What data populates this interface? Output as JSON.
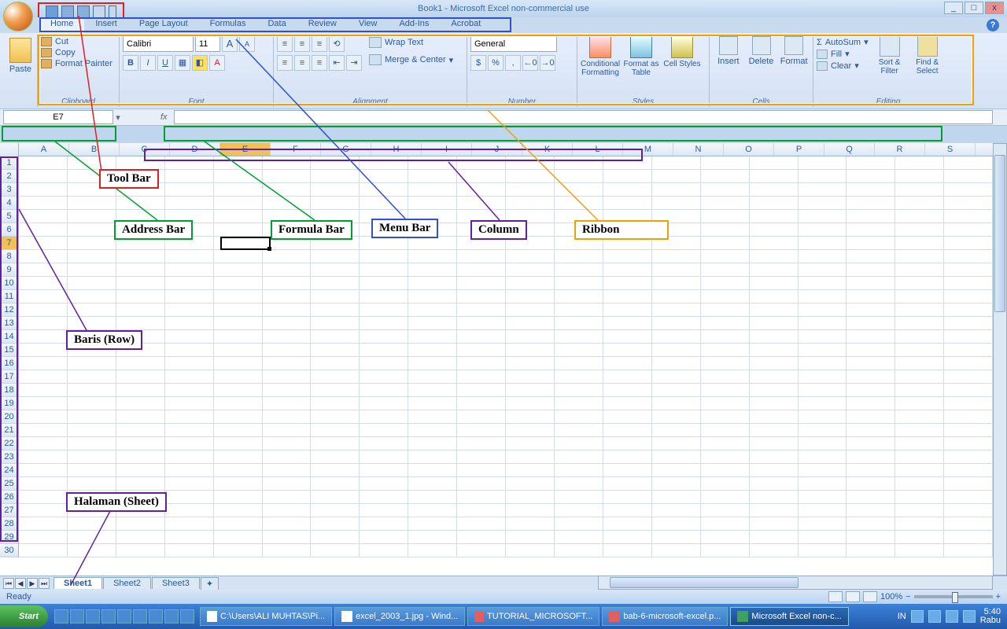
{
  "title": "Book1 - Microsoft Excel non-commercial use",
  "window": {
    "min": "_",
    "max": "□",
    "close": "x"
  },
  "tabs": [
    "Home",
    "Insert",
    "Page Layout",
    "Formulas",
    "Data",
    "Review",
    "View",
    "Add-Ins",
    "Acrobat"
  ],
  "clipboard": {
    "paste": "Paste",
    "cut": "Cut",
    "copy": "Copy",
    "fmt": "Format Painter",
    "label": "Clipboard"
  },
  "font": {
    "name": "Calibri",
    "size": "11",
    "grow": "A",
    "shrink": "A",
    "b": "B",
    "i": "I",
    "u": "U",
    "label": "Font"
  },
  "alignment": {
    "wrap": "Wrap Text",
    "merge": "Merge & Center",
    "label": "Alignment"
  },
  "number": {
    "format": "General",
    "label": "Number",
    "pct": "%",
    "comma": ",",
    "inc": ".0",
    "dec": ".00"
  },
  "styles": {
    "cond": "Conditional Formatting",
    "fmt": "Format as Table",
    "cell": "Cell Styles",
    "label": "Styles"
  },
  "cells": {
    "insert": "Insert",
    "delete": "Delete",
    "format": "Format",
    "label": "Cells"
  },
  "editing": {
    "sum": "AutoSum",
    "fill": "Fill",
    "clear": "Clear",
    "sort": "Sort & Filter",
    "find": "Find & Select",
    "label": "Editing"
  },
  "namebox": "E7",
  "fx": "fx",
  "columns": [
    "A",
    "B",
    "C",
    "D",
    "E",
    "F",
    "G",
    "H",
    "I",
    "J",
    "K",
    "L",
    "M",
    "N",
    "O",
    "P",
    "Q",
    "R",
    "S"
  ],
  "active": {
    "col": "E",
    "row": 7
  },
  "sheets": [
    "Sheet1",
    "Sheet2",
    "Sheet3"
  ],
  "status": {
    "ready": "Ready",
    "zoom": "100%",
    "lang": "IN"
  },
  "annotations": {
    "toolbar": "Tool Bar",
    "address": "Address Bar",
    "formula": "Formula Bar",
    "menu": "Menu Bar",
    "column": "Column",
    "ribbon": "Ribbon",
    "row": "Baris (Row)",
    "sheet": "Halaman (Sheet)"
  },
  "taskbar": {
    "start": "Start",
    "items": [
      "C:\\Users\\ALI MUHTAS\\Pi...",
      "excel_2003_1.jpg - Wind...",
      "TUTORIAL_MICROSOFT...",
      "bab-6-microsoft-excel.p...",
      "Microsoft Excel non-c..."
    ],
    "time": "5:40",
    "day": "Rabu"
  },
  "sigma": "Σ"
}
